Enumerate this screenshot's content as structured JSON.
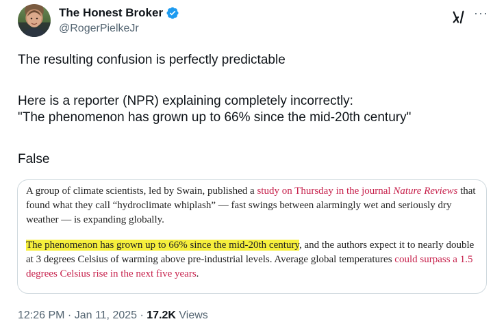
{
  "author": {
    "display_name": "The Honest Broker",
    "handle": "@RogerPielkeJr"
  },
  "tweet": {
    "line1": "The resulting confusion is perfectly predictable",
    "line2": "Here is a reporter (NPR) explaining completely incorrectly:",
    "line3": "\"The phenomenon has grown up to 66% since the mid-20th century\"",
    "line4": "False"
  },
  "card": {
    "p1_a": "A group of climate scientists, led by Swain, published a ",
    "p1_link_a": "study on Thursday in the journal ",
    "p1_link_b": "Nature Reviews",
    "p1_b": " that found what they call “hydroclimate whiplash” — fast swings between alarmingly wet and seriously dry weather — is expanding globally.",
    "p2_highlight": "The phenomenon has grown up to 66% since the mid-20th century",
    "p2_a": ", and the authors expect it to nearly double at 3 degrees Celsius of warming above pre-industrial levels. Average global temperatures ",
    "p2_link": "could surpass a 1.5 degrees Celsius rise in the next five years",
    "p2_b": "."
  },
  "meta": {
    "time": "12:26 PM",
    "sep1": " · ",
    "date": "Jan 11, 2025",
    "sep2": " · ",
    "views_count": "17.2K",
    "views_label": " Views"
  },
  "colors": {
    "verified": "#1d9bf0",
    "link": "#c61f4a",
    "highlight": "#f6ef3c",
    "secondary_text": "#536471"
  },
  "icons": [
    "verified-badge-icon",
    "grok-icon",
    "more-icon"
  ]
}
